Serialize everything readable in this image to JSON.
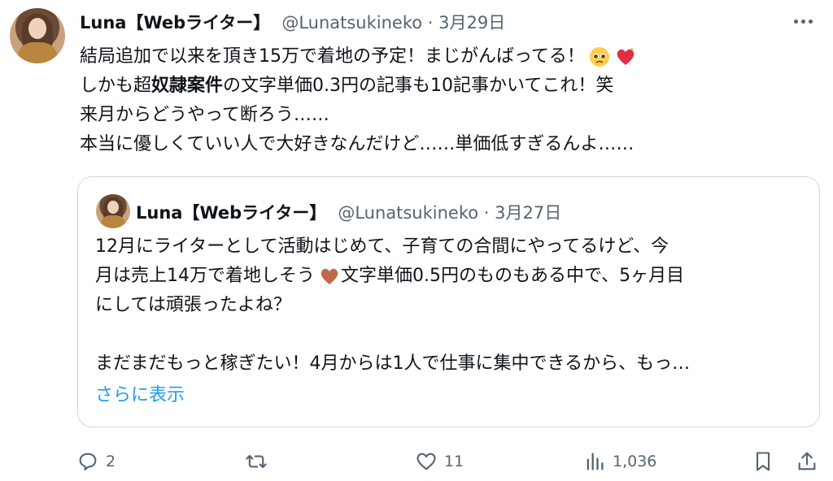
{
  "tweet": {
    "author_name": "Luna【Webライター】",
    "handle": "@Lunatsukineko",
    "date": "3月29日",
    "lines": [
      "結局追加で以来を頂き15万で着地の予定！まじがんばってる！",
      "しかも超",
      "奴隷案件",
      "の文字単価0.3円の記事も10記事かいてこれ！笑",
      "来月からどうやって断ろう……",
      "本当に優しくていい人で大好きなんだけど……単価低すぎるんよ……"
    ]
  },
  "quote": {
    "author_name": "Luna【Webライター】",
    "handle": "@Lunatsukineko",
    "date": "3月27日",
    "line1": "12月にライターとして活動はじめて、子育ての合間にやってるけど、今",
    "line2a": "月は売上14万で着地しそう",
    "line2b": "文字単価0.5円のものもある中で、5ヶ月目",
    "line3": "にしては頑張ったよね？",
    "line4": "まだまだもっと稼ぎたい！4月からは1人で仕事に集中できるから、もっ…",
    "show_more": "さらに表示"
  },
  "actions": {
    "reply_count": "2",
    "retweet_count": "",
    "like_count": "11",
    "view_count": "1,036"
  },
  "icons": {
    "more": "more-icon",
    "reply": "reply-icon",
    "retweet": "retweet-icon",
    "like": "heart-icon",
    "views": "views-icon",
    "bookmark": "bookmark-icon",
    "share": "share-icon"
  },
  "colors": {
    "text": "#0f1419",
    "muted": "#536471",
    "link": "#1d9bf0",
    "border": "#cfd9de"
  }
}
